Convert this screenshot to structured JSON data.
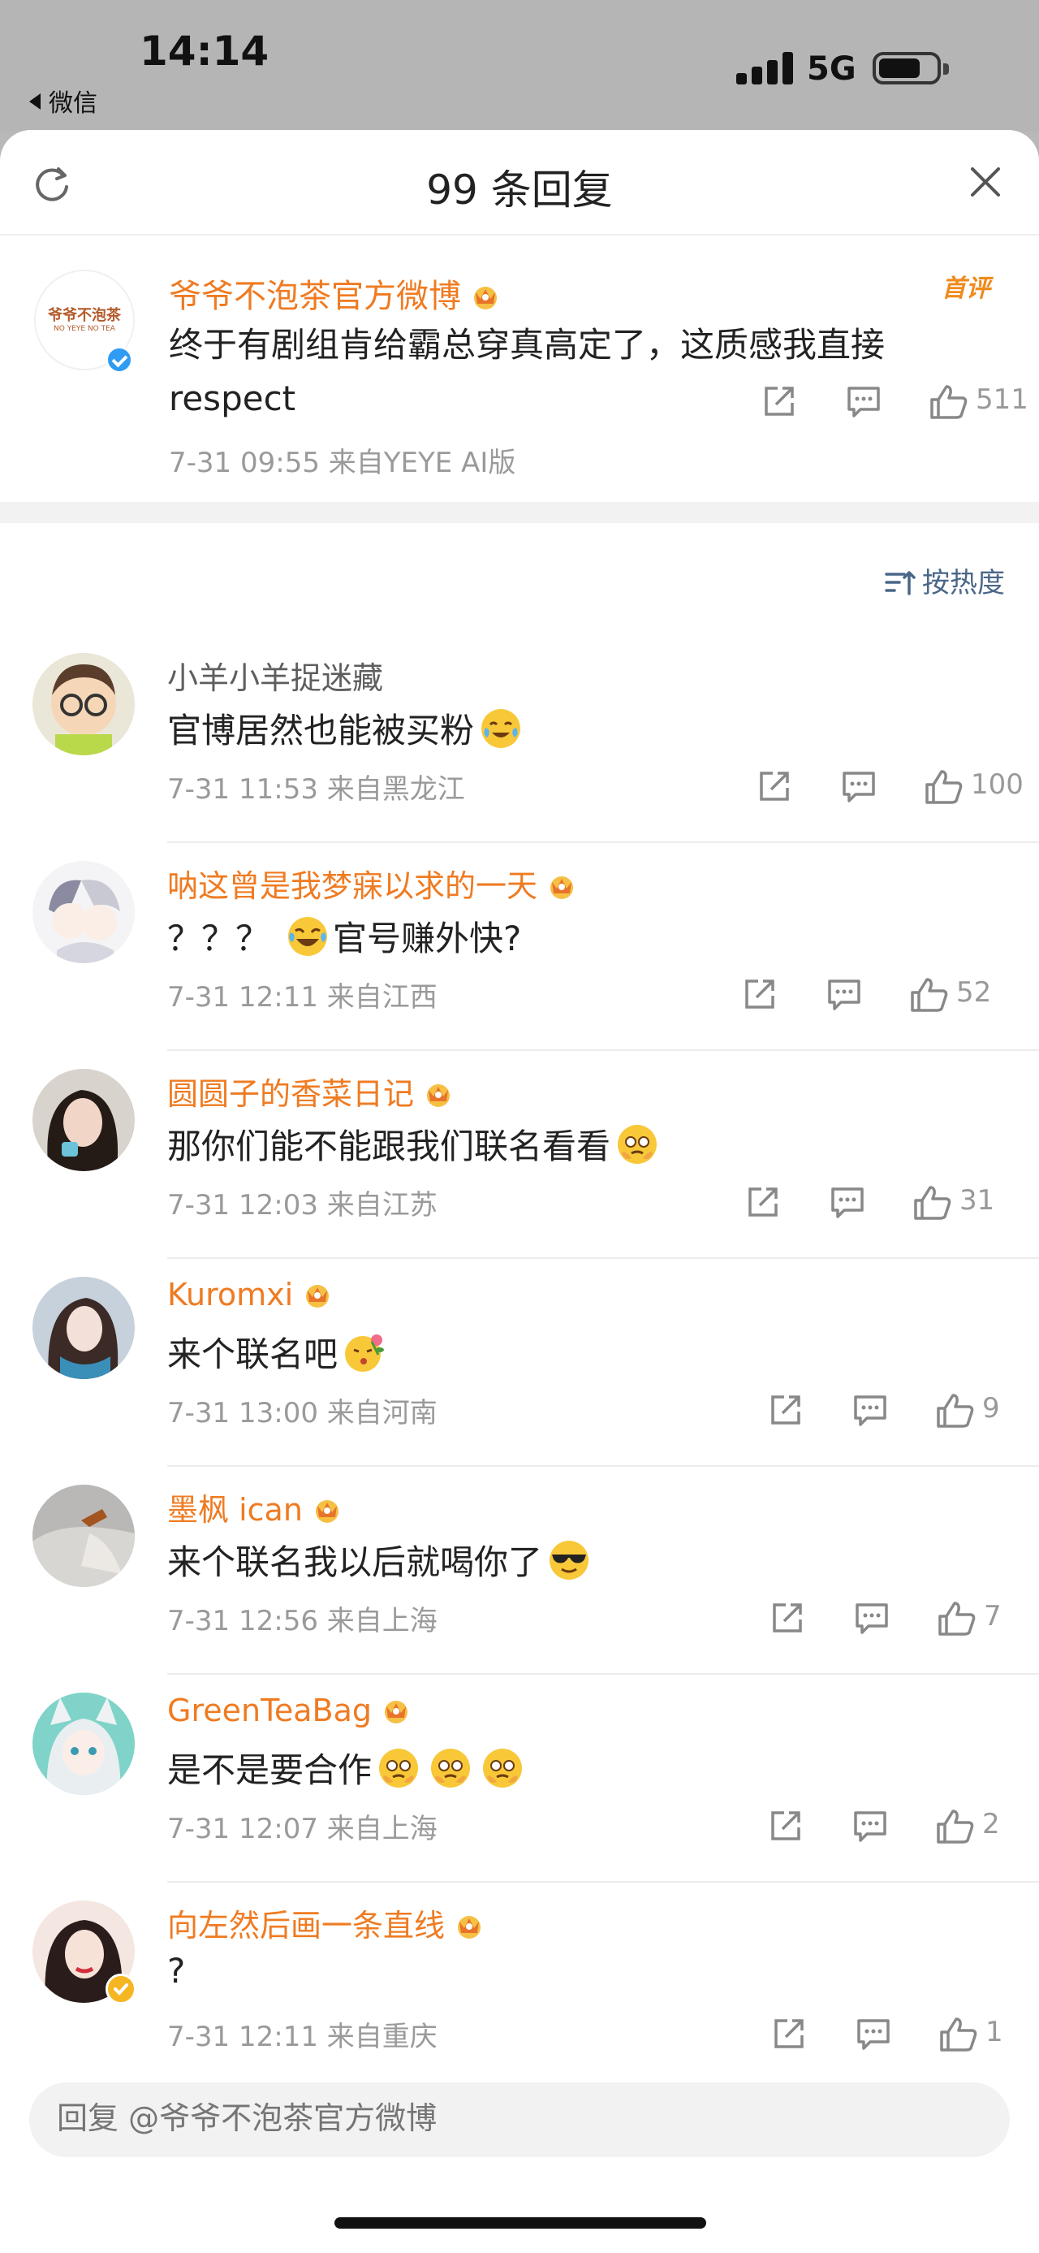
{
  "status_bar": {
    "time": "14:14",
    "back_app": "微信",
    "network": "5G"
  },
  "sheet": {
    "title": "99 条回复"
  },
  "root_comment": {
    "author": "爷爷不泡茶官方微博",
    "avatar_logo": "爷爷不泡茶",
    "avatar_logo_sub": "NO YEYE NO TEA",
    "badge": "首评",
    "text": "终于有剧组肯给霸总穿真高定了，这质感我直接 respect",
    "meta": "7-31 09:55  来自YEYE AI版",
    "likes": "511"
  },
  "sort": {
    "label": "按热度"
  },
  "replies": [
    {
      "author": "小羊小羊捉迷藏",
      "text": "官博居然也能被买粉",
      "meta": "7-31 11:53  来自黑龙江",
      "likes": "100"
    },
    {
      "author": "呐这曾是我梦寐以求的一天",
      "text": "？？？",
      "text2": "官号赚外快?",
      "meta": "7-31 12:11  来自江西",
      "likes": "52"
    },
    {
      "author": "圆圆子的香菜日记",
      "text": "那你们能不能跟我们联名看看",
      "meta": "7-31 12:03  来自江苏",
      "likes": "31"
    },
    {
      "author": "Kuromxi",
      "text": "来个联名吧",
      "meta": "7-31 13:00  来自河南",
      "likes": "9"
    },
    {
      "author": "墨枫 ican",
      "text": "来个联名我以后就喝你了",
      "meta": "7-31 12:56  来自上海",
      "likes": "7"
    },
    {
      "author": "GreenTeaBag",
      "text": "是不是要合作",
      "meta": "7-31 12:07  来自上海",
      "likes": "2"
    },
    {
      "author": "向左然后画一条直线",
      "text": "?",
      "meta": "7-31 12:11  来自重庆",
      "likes": "1"
    }
  ],
  "reply_input": {
    "placeholder": "回复 @爷爷不泡茶官方微博"
  },
  "colors": {
    "username": "#ef7b22",
    "link": "#4a6788",
    "muted": "#9a9a9a"
  }
}
